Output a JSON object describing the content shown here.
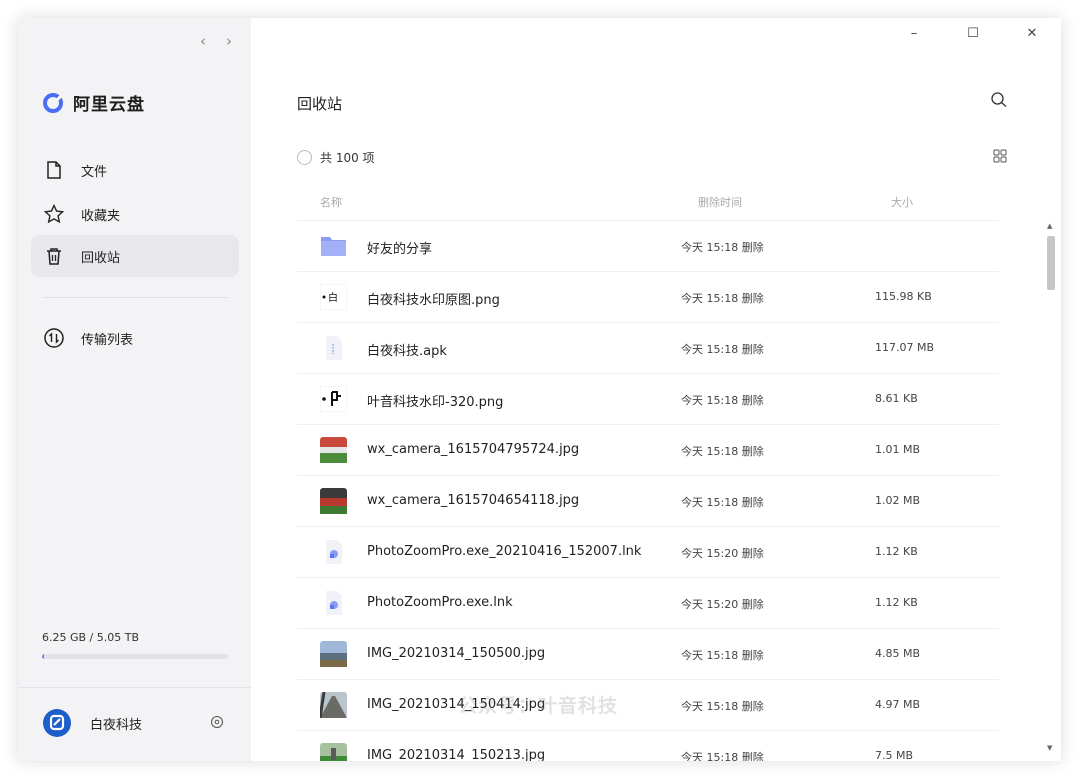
{
  "window_controls": {
    "minimize": "–",
    "maximize": "☐",
    "close": "✕"
  },
  "nav": {
    "back": "‹",
    "forward": "›"
  },
  "app": {
    "name": "阿里云盘"
  },
  "sidebar": {
    "items": [
      {
        "label": "文件",
        "icon": "file-icon"
      },
      {
        "label": "收藏夹",
        "icon": "star-icon"
      },
      {
        "label": "回收站",
        "icon": "trash-icon",
        "active": true
      },
      {
        "label": "传输列表",
        "icon": "transfer-icon"
      }
    ],
    "storage": {
      "text": "6.25 GB / 5.05 TB",
      "used_fraction": 0.0012
    },
    "user": {
      "name": "白夜科技"
    }
  },
  "page": {
    "title": "回收站",
    "count": "共 100 项"
  },
  "columns": {
    "name": "名称",
    "time": "删除时间",
    "size": "大小"
  },
  "files": [
    {
      "name": "好友的分享",
      "time": "今天 15:18 删除",
      "size": "",
      "icon": "folder"
    },
    {
      "name": "白夜科技水印原图.png",
      "time": "今天 15:18 删除",
      "size": "115.98 KB",
      "icon": "logo-thumb"
    },
    {
      "name": "白夜科技.apk",
      "time": "今天 15:18 删除",
      "size": "117.07 MB",
      "icon": "apk"
    },
    {
      "name": "叶音科技水印-320.png",
      "time": "今天 15:18 删除",
      "size": "8.61 KB",
      "icon": "logo-thumb2"
    },
    {
      "name": "wx_camera_1615704795724.jpg",
      "time": "今天 15:18 删除",
      "size": "1.01 MB",
      "icon": "photo-field"
    },
    {
      "name": "wx_camera_1615704654118.jpg",
      "time": "今天 15:18 删除",
      "size": "1.02 MB",
      "icon": "photo-track"
    },
    {
      "name": "PhotoZoomPro.exe_20210416_152007.lnk",
      "time": "今天 15:20 删除",
      "size": "1.12 KB",
      "icon": "shortcut"
    },
    {
      "name": "PhotoZoomPro.exe.lnk",
      "time": "今天 15:20 删除",
      "size": "1.12 KB",
      "icon": "shortcut"
    },
    {
      "name": "IMG_20210314_150500.jpg",
      "time": "今天 15:18 删除",
      "size": "4.85 MB",
      "icon": "photo-city"
    },
    {
      "name": "IMG_20210314_150414.jpg",
      "time": "今天 15:18 删除",
      "size": "4.97 MB",
      "icon": "photo-road"
    },
    {
      "name": "IMG_20210314_150213.jpg",
      "time": "今天 15:18 删除",
      "size": "7.5 MB",
      "icon": "photo-green"
    }
  ],
  "watermark": "公众号：叶音科技",
  "colors": {
    "accent": "#4a6cf7",
    "sidebar_bg": "#f3f3f5",
    "folder": "#8c9cf5"
  }
}
